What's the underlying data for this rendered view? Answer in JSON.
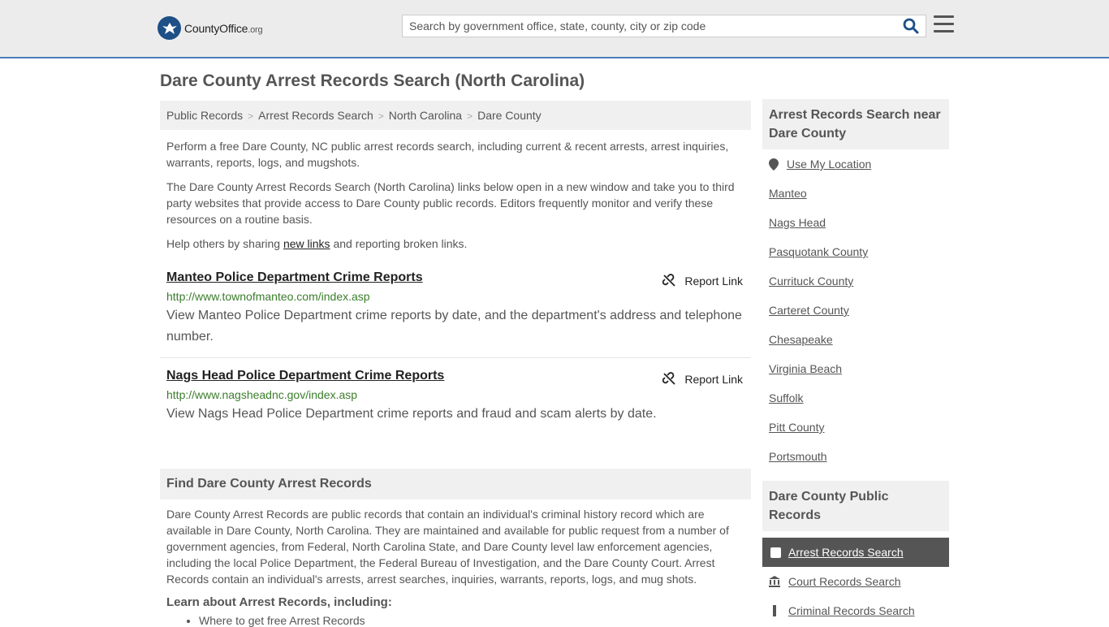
{
  "header": {
    "logo_main": "CountyOffice",
    "logo_suffix": ".org",
    "search_placeholder": "Search by government office, state, county, city or zip code"
  },
  "page_title": "Dare County Arrest Records Search (North Carolina)",
  "breadcrumb": [
    "Public Records",
    "Arrest Records Search",
    "North Carolina",
    "Dare County"
  ],
  "intro": {
    "p1": "Perform a free Dare County, NC public arrest records search, including current & recent arrests, arrest inquiries, warrants, reports, logs, and mugshots.",
    "p2": "The Dare County Arrest Records Search (North Carolina) links below open in a new window and take you to third party websites that provide access to Dare County public records. Editors frequently monitor and verify these resources on a routine basis.",
    "p3_before": "Help others by sharing ",
    "p3_link": "new links",
    "p3_after": " and reporting broken links."
  },
  "results": [
    {
      "title": "Manteo Police Department Crime Reports",
      "report_label": "Report Link",
      "url": "http://www.townofmanteo.com/index.asp",
      "desc": "View Manteo Police Department crime reports by date, and the department's address and telephone number."
    },
    {
      "title": "Nags Head Police Department Crime Reports",
      "report_label": "Report Link",
      "url": "http://www.nagsheadnc.gov/index.asp",
      "desc": "View Nags Head Police Department crime reports and fraud and scam alerts by date."
    }
  ],
  "find_section": {
    "title": "Find Dare County Arrest Records",
    "body": "Dare County Arrest Records are public records that contain an individual's criminal history record which are available in Dare County, North Carolina. They are maintained and available for public request from a number of government agencies, from Federal, North Carolina State, and Dare County level law enforcement agencies, including the local Police Department, the Federal Bureau of Investigation, and the Dare County Court. Arrest Records contain an individual's arrests, arrest searches, inquiries, warrants, reports, logs, and mug shots.",
    "learn_title": "Learn about Arrest Records, including:",
    "learn_items": [
      "Where to get free Arrest Records"
    ]
  },
  "sidebar": {
    "nearby_title": "Arrest Records Search near Dare County",
    "use_location": "Use My Location",
    "nearby_links": [
      "Manteo",
      "Nags Head",
      "Pasquotank County",
      "Currituck County",
      "Carteret County",
      "Chesapeake",
      "Virginia Beach",
      "Suffolk",
      "Pitt County",
      "Portsmouth"
    ],
    "public_records_title": "Dare County Public Records",
    "active_item": "Arrest Records Search",
    "other_items": [
      "Court Records Search",
      "Criminal Records Search"
    ]
  }
}
